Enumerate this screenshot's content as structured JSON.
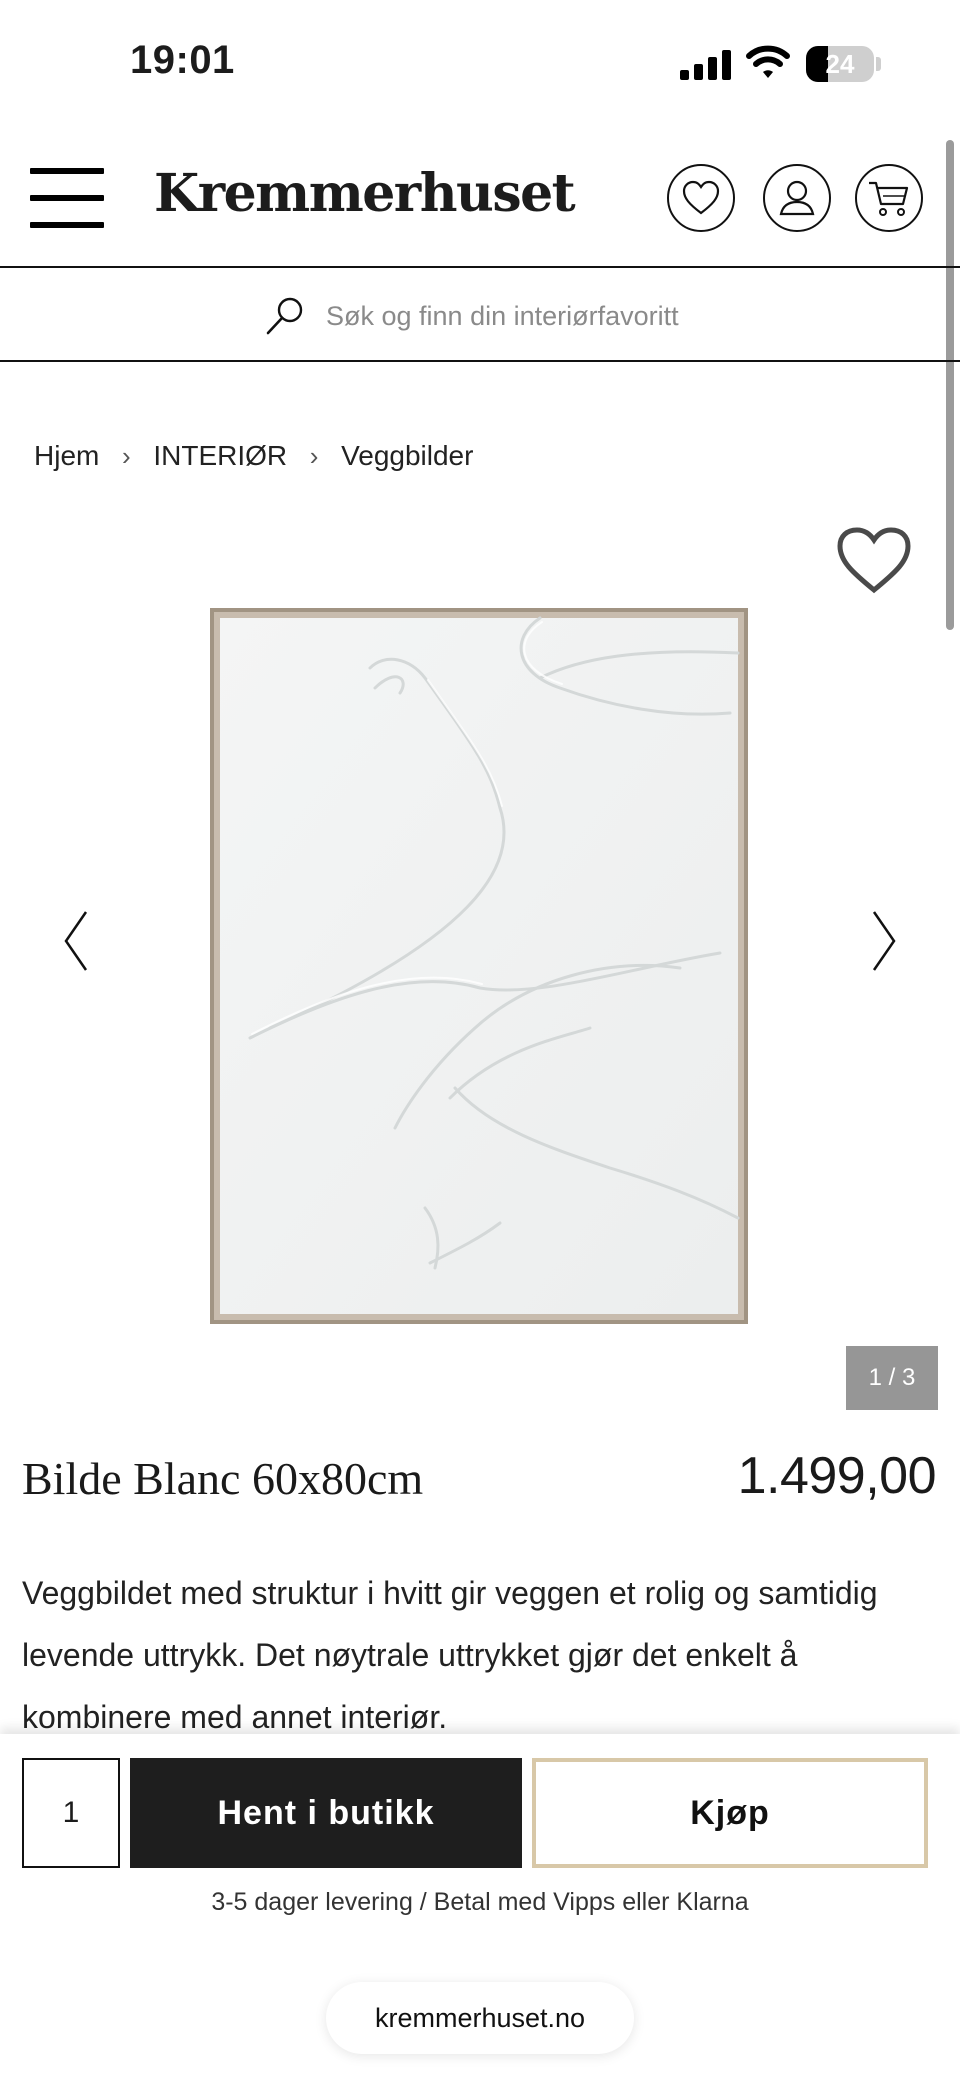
{
  "status_bar": {
    "time": "19:01",
    "battery": "24",
    "icons": [
      "signal-icon",
      "wifi-icon",
      "battery-icon"
    ]
  },
  "header": {
    "logo": "Kremmerhuset",
    "icons": [
      "menu-icon",
      "heart-icon",
      "user-icon",
      "cart-icon"
    ]
  },
  "search": {
    "placeholder": "Søk og finn din interiørfavoritt",
    "icon": "search-icon"
  },
  "breadcrumb": {
    "items": [
      "Hjem",
      "INTERIØR",
      "Veggbilder"
    ],
    "separator": "›"
  },
  "gallery": {
    "counter": "1 / 3",
    "current": 1,
    "total": 3,
    "icons": [
      "favorite-icon",
      "chevron-left-icon",
      "chevron-right-icon"
    ]
  },
  "product": {
    "title": "Bilde Blanc 60x80cm",
    "price": "1.499,00",
    "description": "Veggbildet med struktur i hvitt gir veggen et rolig og samtidig levende uttrykk. Det nøytrale uttrykket gjør det enkelt å kombinere med annet interiør."
  },
  "purchase": {
    "quantity": "1",
    "store_button": "Hent i butikk",
    "buy_button": "Kjøp",
    "delivery_info": "3-5 dager levering / Betal med Vipps eller Klarna"
  },
  "browser": {
    "url": "kremmerhuset.no"
  },
  "colors": {
    "primary_button": "#1e1e1e",
    "buy_button_border": "#d8c8a8",
    "counter_bg": "#969696"
  }
}
